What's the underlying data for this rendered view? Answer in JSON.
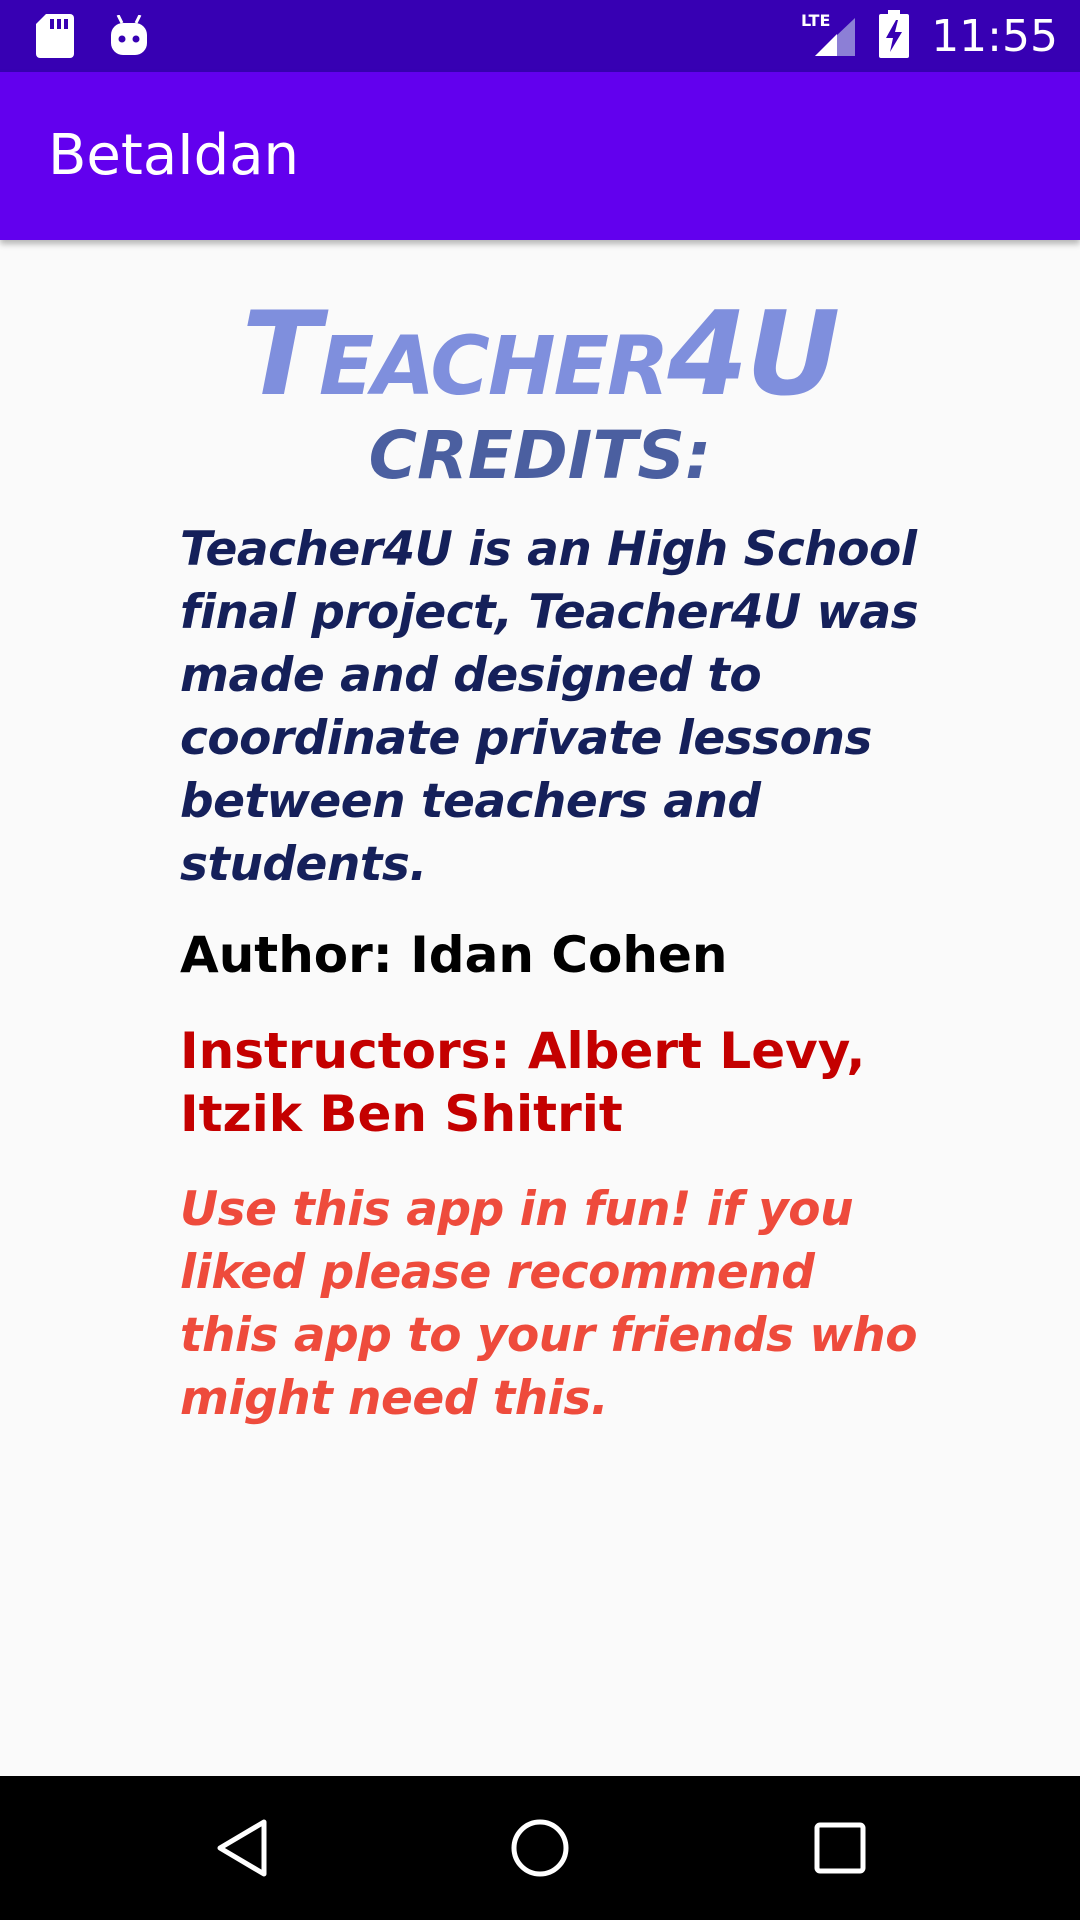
{
  "status_bar": {
    "time": "11:55",
    "network": "LTE",
    "icons": [
      "sd-card-icon",
      "android-debug-icon",
      "lte-signal-icon",
      "battery-charging-icon"
    ]
  },
  "app_bar": {
    "title": "BetaIdan"
  },
  "main": {
    "brand": "Teacher4U",
    "credits_heading": "CREDITS:",
    "description": "Teacher4U is an High School final project, Teacher4U was made and designed to coordinate private lessons between teachers and students.",
    "author": "Author: Idan Cohen",
    "instructors": "Instructors: Albert Levy, Itzik Ben Shitrit",
    "footer_note": "Use this app in fun! if you liked please recommend this app to your friends who might need this."
  },
  "nav_bar": {
    "buttons": [
      "back-icon",
      "home-icon",
      "recents-icon"
    ]
  },
  "colors": {
    "status_bar": "#3700b3",
    "app_bar": "#6200ee",
    "brand": "#7f8fdd",
    "credits_heading": "#4b5fa0",
    "description": "#15205a",
    "instructors": "#c40000",
    "footer_note": "#ee4b3c"
  }
}
